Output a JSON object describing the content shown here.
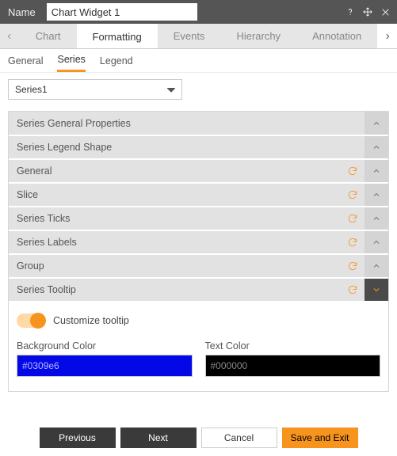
{
  "titlebar": {
    "name_label": "Name",
    "name_value": "Chart Widget 1"
  },
  "tabs": {
    "items": [
      "Chart",
      "Formatting",
      "Events",
      "Hierarchy",
      "Annotation"
    ],
    "active_index": 1
  },
  "subtabs": {
    "items": [
      "General",
      "Series",
      "Legend"
    ],
    "active_index": 1
  },
  "series_selector": {
    "value": "Series1"
  },
  "accordion": {
    "items": [
      {
        "label": "Series General Properties",
        "has_refresh": false,
        "open": false
      },
      {
        "label": "Series Legend Shape",
        "has_refresh": false,
        "open": false
      },
      {
        "label": "General",
        "has_refresh": true,
        "open": false
      },
      {
        "label": "Slice",
        "has_refresh": true,
        "open": false
      },
      {
        "label": "Series Ticks",
        "has_refresh": true,
        "open": false
      },
      {
        "label": "Series Labels",
        "has_refresh": true,
        "open": false
      },
      {
        "label": "Group",
        "has_refresh": true,
        "open": false
      },
      {
        "label": "Series Tooltip",
        "has_refresh": true,
        "open": true
      }
    ]
  },
  "tooltip_panel": {
    "toggle_label": "Customize tooltip",
    "bg_label": "Background Color",
    "bg_value": "#0309e6",
    "tc_label": "Text Color",
    "tc_value": "#000000"
  },
  "footer": {
    "previous": "Previous",
    "next": "Next",
    "cancel": "Cancel",
    "save_exit": "Save and Exit"
  }
}
